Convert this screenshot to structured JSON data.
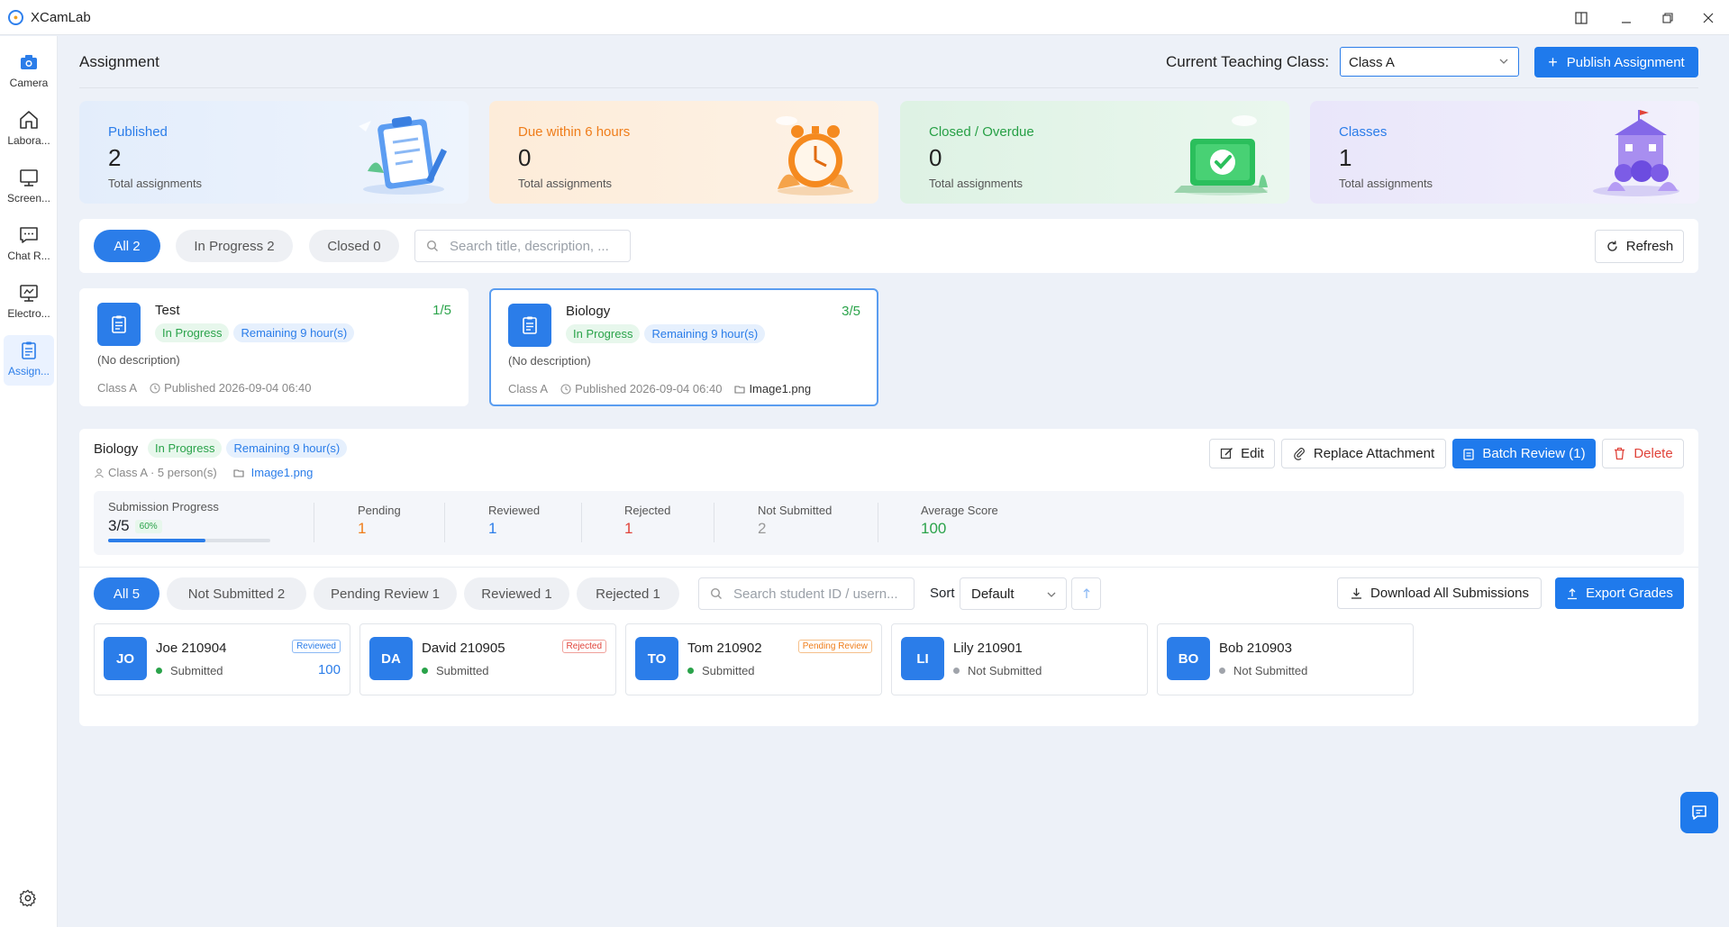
{
  "app": {
    "title": "XCamLab"
  },
  "sidebar": {
    "items": [
      {
        "label": "Camera"
      },
      {
        "label": "Labora..."
      },
      {
        "label": "Screen..."
      },
      {
        "label": "Chat R..."
      },
      {
        "label": "Electro..."
      },
      {
        "label": "Assign..."
      }
    ]
  },
  "header": {
    "title": "Assignment",
    "class_label": "Current Teaching Class:",
    "class_value": "Class A",
    "publish_label": "Publish Assignment"
  },
  "stats": [
    {
      "label": "Published",
      "value": "2",
      "sub": "Total assignments",
      "color": "#2b7de9",
      "bg": "#e4eefc"
    },
    {
      "label": "Due within 6 hours",
      "value": "0",
      "sub": "Total assignments",
      "color": "#ef7d1a",
      "bg": "#fdeedd"
    },
    {
      "label": "Closed / Overdue",
      "value": "0",
      "sub": "Total assignments",
      "color": "#27a046",
      "bg": "#e3f4e8"
    },
    {
      "label": "Classes",
      "value": "1",
      "sub": "Total assignments",
      "color": "#2b7de9",
      "bg": "#ece8fa"
    }
  ],
  "filters": {
    "tabs": [
      {
        "label": "All 2"
      },
      {
        "label": "In Progress 2"
      },
      {
        "label": "Closed 0"
      }
    ],
    "search_placeholder": "Search title, description, ...",
    "refresh_label": "Refresh"
  },
  "assignments": [
    {
      "name": "Test",
      "ratio": "1/5",
      "status": "In Progress",
      "remaining": "Remaining 9 hour(s)",
      "description": "(No description)",
      "class": "Class A",
      "published": "Published 2026-09-04 06:40",
      "file": ""
    },
    {
      "name": "Biology",
      "ratio": "3/5",
      "status": "In Progress",
      "remaining": "Remaining 9 hour(s)",
      "description": "(No description)",
      "class": "Class A",
      "published": "Published 2026-09-04 06:40",
      "file": "Image1.png"
    }
  ],
  "detail": {
    "title": "Biology",
    "status": "In Progress",
    "remaining": "Remaining 9 hour(s)",
    "meta": "Class A · 5 person(s)",
    "file": "Image1.png",
    "actions": {
      "edit": "Edit",
      "replace": "Replace Attachment",
      "batch": "Batch Review (1)",
      "delete": "Delete"
    },
    "progress": {
      "label": "Submission Progress",
      "value": "3/5",
      "percent": "60%",
      "fraction": 0.6,
      "pending_label": "Pending",
      "pending": "1",
      "reviewed_label": "Reviewed",
      "reviewed": "1",
      "rejected_label": "Rejected",
      "rejected": "1",
      "not_submitted_label": "Not Submitted",
      "not_submitted": "2",
      "avg_label": "Average Score",
      "avg": "100"
    },
    "student_tabs": [
      {
        "label": "All 5"
      },
      {
        "label": "Not Submitted 2"
      },
      {
        "label": "Pending Review 1"
      },
      {
        "label": "Reviewed 1"
      },
      {
        "label": "Rejected 1"
      }
    ],
    "student_search_placeholder": "Search student ID / usern...",
    "sort_label": "Sort",
    "sort_value": "Default",
    "download_label": "Download All Submissions",
    "export_label": "Export Grades",
    "students": [
      {
        "initials": "JO",
        "name": "Joe 210904",
        "status": "Submitted",
        "badge": "Reviewed",
        "badge_color": "#2b7de9",
        "score": "100",
        "dot": "#2aa34a"
      },
      {
        "initials": "DA",
        "name": "David 210905",
        "status": "Submitted",
        "badge": "Rejected",
        "badge_color": "#e0433a",
        "score": "",
        "dot": "#2aa34a"
      },
      {
        "initials": "TO",
        "name": "Tom 210902",
        "status": "Submitted",
        "badge": "Pending Review",
        "badge_color": "#ef7d1a",
        "score": "",
        "dot": "#2aa34a"
      },
      {
        "initials": "LI",
        "name": "Lily 210901",
        "status": "Not Submitted",
        "badge": "",
        "badge_color": "",
        "score": "",
        "dot": "#a0a4ab"
      },
      {
        "initials": "BO",
        "name": "Bob 210903",
        "status": "Not Submitted",
        "badge": "",
        "badge_color": "",
        "score": "",
        "dot": "#a0a4ab"
      }
    ]
  }
}
